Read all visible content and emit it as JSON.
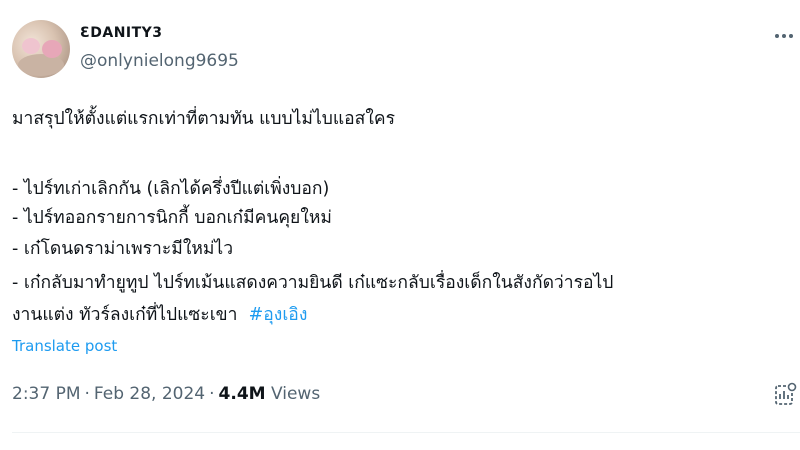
{
  "user": {
    "display_name": "ƐDANITY3",
    "handle": "@onlynielong9695"
  },
  "post": {
    "lines": [
      "มาสรุปให้ตั้งแต่แรกเท่าที่ตามทัน แบบไม่ไบแอสใคร",
      "- ไปร์ทเก่าเลิกกัน (เลิกได้ครึ่งปีแต่เพิ่งบอก)",
      "- ไปร์ทออกรายการนิกกี้ บอกเก๋มีคนคุยใหม่",
      "- เก๋โดนดราม่าเพราะมีใหม่ไว",
      "- เก๋กลับมาทำยูทูป ไปร์ทเม้นแสดงความยินดี เก๋แซะกลับเรื่องเด็กในสังกัดว่ารอไป",
      "งานแต่ง ทัวร์ลงเก๋ที่ไปแซะเขา"
    ],
    "hashtag": "#อุงเอิง",
    "translate_label": "Translate post"
  },
  "meta": {
    "time": "2:37 PM",
    "separator": "·",
    "date": "Feb 28, 2024",
    "views_count": "4.4M",
    "views_label": "Views"
  },
  "icons": {
    "more": "more-options-icon",
    "stats": "post-analytics-icon"
  },
  "colors": {
    "link": "#1d9bf0",
    "secondary_text": "#536471",
    "primary_text": "#0f1419"
  }
}
